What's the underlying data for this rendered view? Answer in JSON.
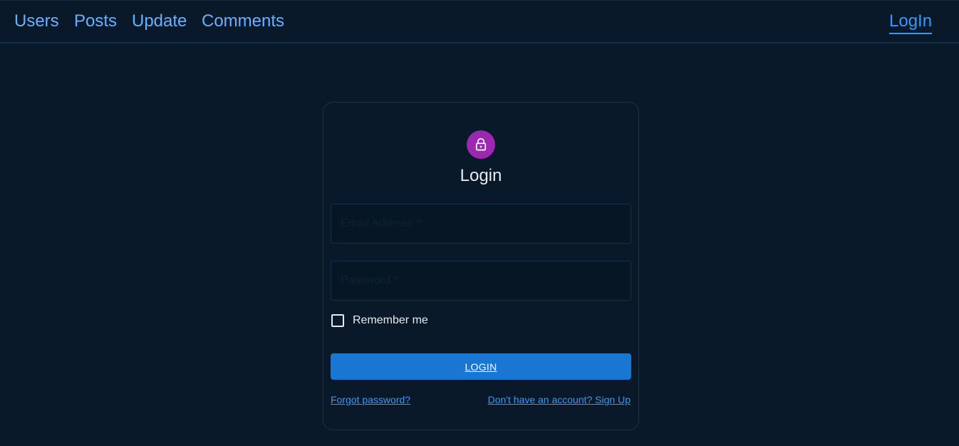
{
  "nav": {
    "links": [
      "Users",
      "Posts",
      "Update",
      "Comments"
    ],
    "login_label": "LogIn"
  },
  "card": {
    "icon": "lock-icon",
    "title": "Login",
    "email_placeholder": "Email Address *",
    "password_placeholder": "Password *",
    "remember_label": "Remember me",
    "remember_checked": false,
    "submit_label": "LOGIN",
    "forgot_label": "Forgot password?",
    "signup_label": "Don't have an account? Sign Up"
  },
  "colors": {
    "background": "#0a1929",
    "nav_link": "#66b2ff",
    "accent": "#3399ff",
    "button": "#1976d2",
    "avatar": "#9c27b0"
  }
}
